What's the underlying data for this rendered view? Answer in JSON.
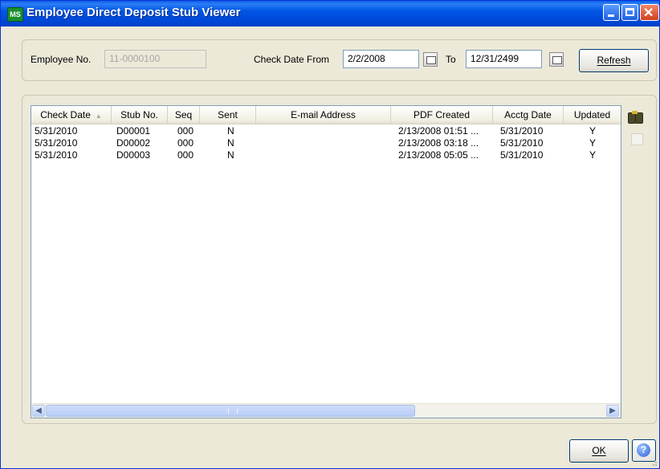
{
  "window": {
    "title": "Employee Direct Deposit Stub Viewer",
    "app_icon_text": "MS"
  },
  "filters": {
    "employee_label": "Employee No.",
    "employee_value": "11-0000100",
    "check_date_from_label": "Check Date From",
    "check_date_from_value": "2/2/2008",
    "to_label": "To",
    "check_date_to_value": "12/31/2499",
    "refresh_label": "Refresh"
  },
  "grid": {
    "columns": [
      "Check Date",
      "Stub No.",
      "Seq",
      "Sent",
      "E-mail Address",
      "PDF Created",
      "Acctg Date",
      "Updated"
    ],
    "sort_column": "Check Date",
    "rows": [
      [
        "5/31/2010",
        "D00001",
        "000",
        "N",
        "",
        "2/13/2008 01:51 ...",
        "5/31/2010",
        "Y"
      ],
      [
        "5/31/2010",
        "D00002",
        "000",
        "N",
        "",
        "2/13/2008 03:18 ...",
        "5/31/2010",
        "Y"
      ],
      [
        "5/31/2010",
        "D00003",
        "000",
        "N",
        "",
        "2/13/2008 05:05 ...",
        "5/31/2010",
        "Y"
      ]
    ]
  },
  "footer": {
    "ok_label": "OK",
    "help_label": "?"
  },
  "colors": {
    "titlebar": "#0055e5",
    "window_bg": "#ece9d8",
    "close_button": "#d1401f"
  },
  "icons": [
    "app-icon",
    "calendar-icon",
    "binoculars-icon",
    "help-icon",
    "minimize-icon",
    "maximize-icon",
    "close-icon"
  ]
}
